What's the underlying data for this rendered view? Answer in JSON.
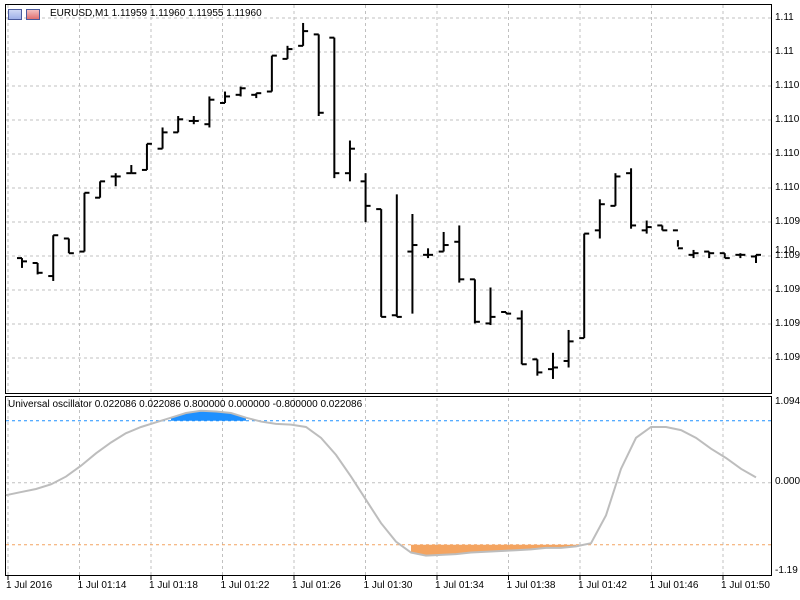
{
  "window": {
    "symbol_header": "EURUSD,M1  1.11959 1.11960 1.11955 1.11960",
    "osc_header": "Universal oscillator 0.022086 0.022086 0.800000 0.000000 -0.800000 0.022086",
    "icons": [
      "table-icon",
      "close-icon"
    ]
  },
  "price_axis": {
    "labels": [
      "1.11",
      "1.11",
      "1.110",
      "1.110",
      "1.110",
      "1.110",
      "1.109",
      "1.109",
      "1.109",
      "1.109",
      "1.109"
    ],
    "last_price_label": "1.10"
  },
  "osc_axis": {
    "labels": [
      "1.094",
      "0.000",
      "-1.19"
    ]
  },
  "time_axis": {
    "labels": [
      "1 Jul 2016",
      "1 Jul 01:14",
      "1 Jul 01:18",
      "1 Jul 01:22",
      "1 Jul 01:26",
      "1 Jul 01:30",
      "1 Jul 01:34",
      "1 Jul 01:38",
      "1 Jul 01:42",
      "1 Jul 01:46",
      "1 Jul 01:50"
    ]
  },
  "colors": {
    "bars": "#000000",
    "grid": "#c0c0c0",
    "osc_line": "#bdbdbd",
    "upper_fill": "#1e90ff",
    "lower_fill": "#f4a460",
    "upper_level": "#1e90ff",
    "lower_level": "#f4a460"
  },
  "chart_data": {
    "type": "ohlc",
    "bars": [
      {
        "o": 1.10958,
        "h": 1.10958,
        "l": 1.10952,
        "c": 1.10956
      },
      {
        "o": 1.10955,
        "h": 1.10955,
        "l": 1.10948,
        "c": 1.10949
      },
      {
        "o": 1.10947,
        "h": 1.10972,
        "l": 1.10944,
        "c": 1.10972
      },
      {
        "o": 1.1097,
        "h": 1.1097,
        "l": 1.10961,
        "c": 1.10961
      },
      {
        "o": 1.10962,
        "h": 1.10998,
        "l": 1.10962,
        "c": 1.10998
      },
      {
        "o": 1.10995,
        "h": 1.11005,
        "l": 1.10995,
        "c": 1.11005
      },
      {
        "o": 1.11008,
        "h": 1.1101,
        "l": 1.11002,
        "c": 1.11008
      },
      {
        "o": 1.1101,
        "h": 1.11015,
        "l": 1.1101,
        "c": 1.1101
      },
      {
        "o": 1.11012,
        "h": 1.11028,
        "l": 1.11012,
        "c": 1.11028
      },
      {
        "o": 1.11025,
        "h": 1.11038,
        "l": 1.11025,
        "c": 1.11035
      },
      {
        "o": 1.11035,
        "h": 1.11045,
        "l": 1.11035,
        "c": 1.11043
      },
      {
        "o": 1.11042,
        "h": 1.11045,
        "l": 1.1104,
        "c": 1.11042
      },
      {
        "o": 1.1104,
        "h": 1.11057,
        "l": 1.11038,
        "c": 1.11055
      },
      {
        "o": 1.11053,
        "h": 1.1106,
        "l": 1.11053,
        "c": 1.11057
      },
      {
        "o": 1.11058,
        "h": 1.11063,
        "l": 1.11057,
        "c": 1.11062
      },
      {
        "o": 1.11058,
        "h": 1.11059,
        "l": 1.11056,
        "c": 1.11059
      },
      {
        "o": 1.1106,
        "h": 1.11082,
        "l": 1.1106,
        "c": 1.11082
      },
      {
        "o": 1.1108,
        "h": 1.11088,
        "l": 1.1108,
        "c": 1.11086
      },
      {
        "o": 1.11088,
        "h": 1.11102,
        "l": 1.11088,
        "c": 1.11097
      },
      {
        "o": 1.11095,
        "h": 1.11095,
        "l": 1.11045,
        "c": 1.11047
      },
      {
        "o": 1.11093,
        "h": 1.11093,
        "l": 1.11007,
        "c": 1.1101
      },
      {
        "o": 1.1101,
        "h": 1.1103,
        "l": 1.11005,
        "c": 1.11025
      },
      {
        "o": 1.11005,
        "h": 1.1101,
        "l": 1.1098,
        "c": 1.1099
      },
      {
        "o": 1.10988,
        "h": 1.10988,
        "l": 1.10922,
        "c": 1.10922
      },
      {
        "o": 1.10923,
        "h": 1.10997,
        "l": 1.10922,
        "c": 1.10922
      },
      {
        "o": 1.10962,
        "h": 1.10985,
        "l": 1.10924,
        "c": 1.10966
      },
      {
        "o": 1.1096,
        "h": 1.10964,
        "l": 1.10958,
        "c": 1.1096
      },
      {
        "o": 1.10962,
        "h": 1.10974,
        "l": 1.10962,
        "c": 1.10966
      },
      {
        "o": 1.10968,
        "h": 1.10978,
        "l": 1.10943,
        "c": 1.10945
      },
      {
        "o": 1.10945,
        "h": 1.10945,
        "l": 1.10918,
        "c": 1.10919
      },
      {
        "o": 1.10918,
        "h": 1.1094,
        "l": 1.10917,
        "c": 1.10922
      },
      {
        "o": 1.10925,
        "h": 1.10925,
        "l": 1.10924,
        "c": 1.10924
      },
      {
        "o": 1.10921,
        "h": 1.10926,
        "l": 1.10893,
        "c": 1.10893
      },
      {
        "o": 1.10896,
        "h": 1.10896,
        "l": 1.10886,
        "c": 1.10888
      },
      {
        "o": 1.1089,
        "h": 1.109,
        "l": 1.10884,
        "c": 1.10891
      },
      {
        "o": 1.10895,
        "h": 1.10914,
        "l": 1.10891,
        "c": 1.10907
      },
      {
        "o": 1.10909,
        "h": 1.10973,
        "l": 1.10909,
        "c": 1.10973
      },
      {
        "o": 1.10975,
        "h": 1.10994,
        "l": 1.1097,
        "c": 1.10991
      },
      {
        "o": 1.1099,
        "h": 1.1101,
        "l": 1.1099,
        "c": 1.11008
      },
      {
        "o": 1.1101,
        "h": 1.11013,
        "l": 1.10976,
        "c": 1.10978
      },
      {
        "o": 1.10975,
        "h": 1.10981,
        "l": 1.10973,
        "c": 1.10977
      },
      {
        "o": 1.10978,
        "h": 1.10978,
        "l": 1.10975,
        "c": 1.10975
      },
      {
        "o": 1.10975,
        "h": 1.10969,
        "l": 1.10965,
        "c": 1.10964
      },
      {
        "o": 1.1096,
        "h": 1.10963,
        "l": 1.10958,
        "c": 1.10961
      },
      {
        "o": 1.10962,
        "h": 1.10962,
        "l": 1.10958,
        "c": 1.10961
      },
      {
        "o": 1.10961,
        "h": 1.10961,
        "l": 1.10958,
        "c": 1.10958
      },
      {
        "o": 1.1096,
        "h": 1.10961,
        "l": 1.10958,
        "c": 1.1096
      },
      {
        "o": 1.10959,
        "h": 1.1096,
        "l": 1.10955,
        "c": 1.1096
      }
    ],
    "price_range": [
      1.10876,
      1.11113
    ],
    "oscillator": {
      "values": [
        -0.16,
        -0.12,
        -0.08,
        -0.02,
        0.08,
        0.22,
        0.38,
        0.52,
        0.64,
        0.72,
        0.78,
        0.84,
        0.9,
        0.93,
        0.92,
        0.9,
        0.84,
        0.79,
        0.76,
        0.75,
        0.72,
        0.58,
        0.36,
        0.08,
        -0.22,
        -0.52,
        -0.76,
        -0.9,
        -0.94,
        -0.93,
        -0.92,
        -0.9,
        -0.89,
        -0.88,
        -0.87,
        -0.86,
        -0.84,
        -0.84,
        -0.82,
        -0.78,
        -0.42,
        0.18,
        0.58,
        0.72,
        0.72,
        0.68,
        0.58,
        0.44,
        0.32,
        0.18,
        0.07
      ],
      "upper_level": 0.8,
      "zero_level": 0.0,
      "lower_level": -0.8,
      "range": [
        -1.19,
        1.094
      ]
    }
  }
}
